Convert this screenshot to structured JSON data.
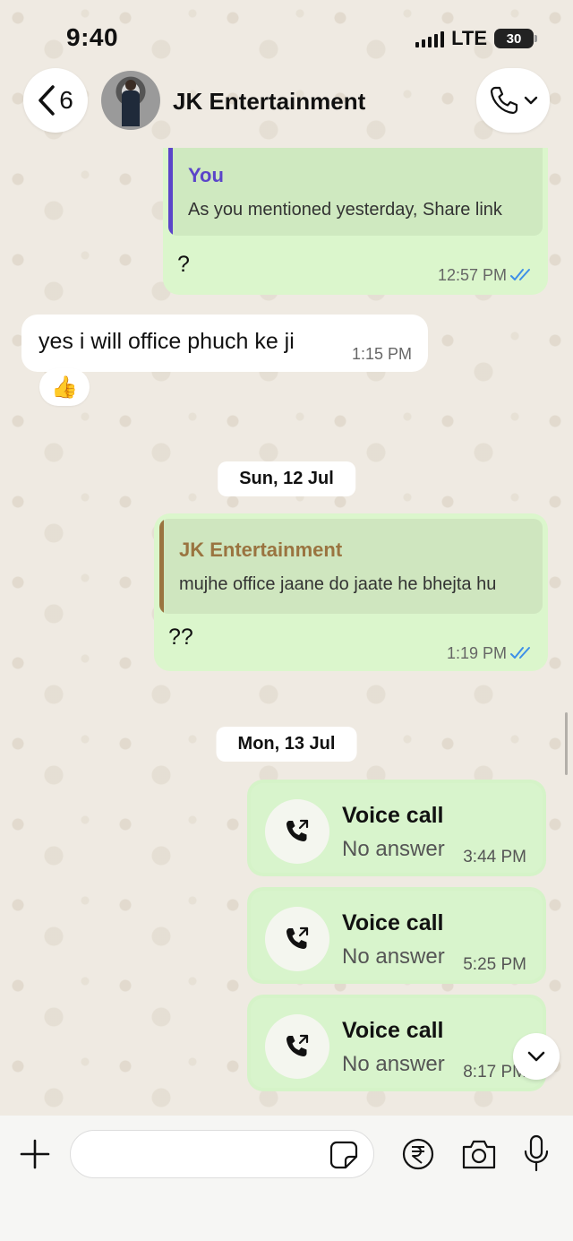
{
  "status_bar": {
    "time": "9:40",
    "network": "LTE",
    "battery": "30"
  },
  "header": {
    "back_count": "6",
    "contact_name": "JK Entertainment"
  },
  "messages": [
    {
      "direction": "out",
      "quote_author": "You",
      "quote_text": "As you mentioned yesterday, Share link",
      "text": "?",
      "time": "12:57 PM",
      "status": "read"
    },
    {
      "direction": "in",
      "text": "yes i will office phuch ke ji",
      "time": "1:15 PM",
      "reaction": "👍"
    },
    {
      "date": "Sun, 12 Jul"
    },
    {
      "direction": "out",
      "quote_author": "JK Entertainment",
      "quote_text": "mujhe office jaane do jaate he bhejta hu",
      "text": "??",
      "time": "1:19 PM",
      "status": "read"
    },
    {
      "date": "Mon, 13 Jul"
    },
    {
      "type": "call",
      "title": "Voice call",
      "status": "No answer",
      "time": "3:44 PM"
    },
    {
      "type": "call",
      "title": "Voice call",
      "status": "No answer",
      "time": "5:25 PM"
    },
    {
      "type": "call",
      "title": "Voice call",
      "status": "No answer",
      "time": "8:17 PM"
    }
  ],
  "composer": {
    "placeholder": ""
  },
  "colors": {
    "accent_you": "#5b45c9",
    "accent_contact": "#9a7440",
    "tick_read": "#3d8fe8",
    "outgoing_bubble": "#dbf6cc"
  },
  "icons": [
    "back-chevron-icon",
    "phone-icon",
    "chevron-down-icon",
    "plus-icon",
    "sticker-icon",
    "rupee-icon",
    "camera-icon",
    "mic-icon",
    "outgoing-call-icon"
  ]
}
